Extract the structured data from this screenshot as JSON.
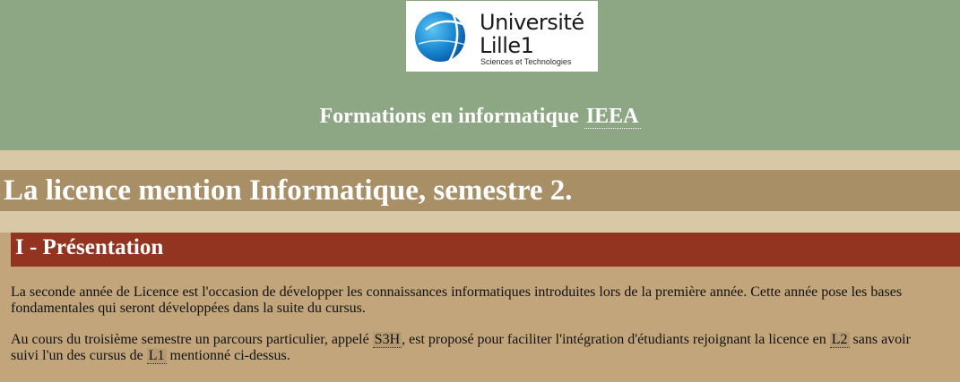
{
  "header": {
    "logo": {
      "line1": "Université",
      "line2": "Lille1",
      "tagline": "Sciences et Technologies"
    },
    "site_title_prefix": "Formations en informatique",
    "site_title_link": "IEEA"
  },
  "page": {
    "title": "La licence mention Informatique, semestre 2."
  },
  "section": {
    "heading": "I - Présentation",
    "para1_line1": "La seconde année de Licence est l'occasion de développer les connaissances informatiques introduites lors de la première année. Cette année pose les bases",
    "para1_line2": "fondamentales qui seront développées dans la suite du cursus.",
    "para2_seg1": "Au cours du troisième semestre un parcours particulier, appelé",
    "para2_abbr1": "S3H",
    "para2_seg2": ", est proposé pour faciliter l'intégration d'étudiants rejoignant la licence en",
    "para2_abbr2": "L2",
    "para2_seg3": "sans avoir",
    "para2_seg4": "suivi l'un des cursus de",
    "para2_abbr3": "L1",
    "para2_seg5": "mentionné ci-dessus."
  },
  "colors": {
    "header_bg": "#8da784",
    "band_bg": "#d9c8a5",
    "title_bar_bg": "#a88f66",
    "section_bar_bg": "#923420",
    "content_bg": "#c2a57a"
  }
}
